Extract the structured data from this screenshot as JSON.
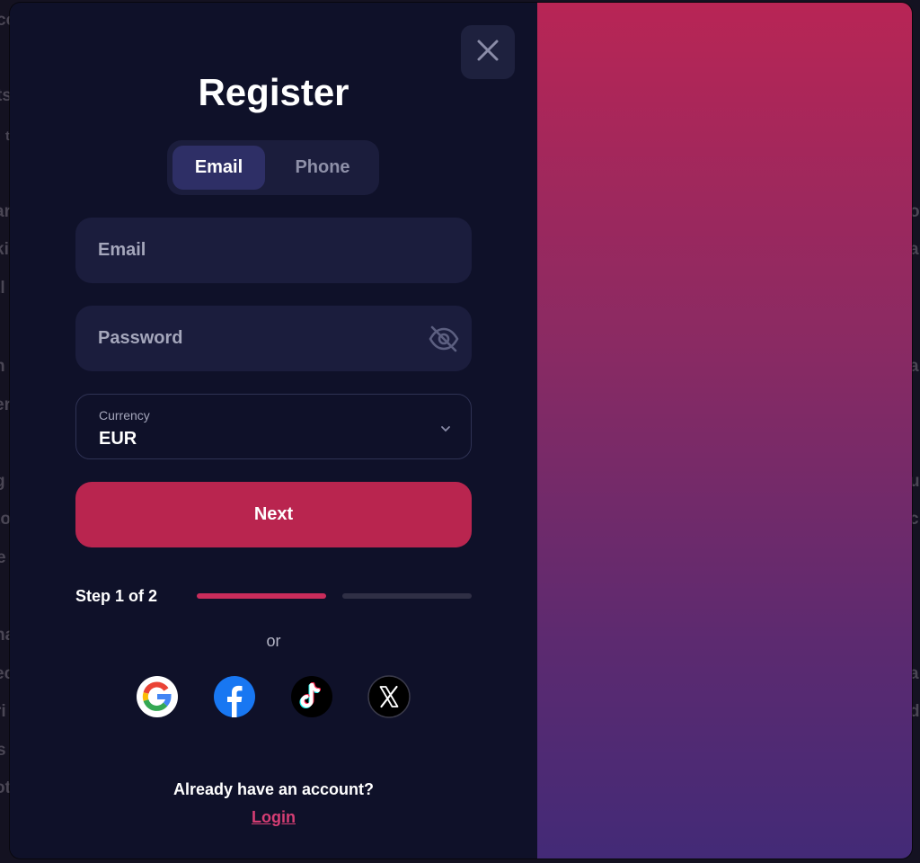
{
  "background": {
    "fragments": [
      "co",
      "ts",
      "t",
      "ar",
      "ki",
      "tl",
      "n",
      "er",
      "g",
      "to",
      "e",
      "ha",
      "ec",
      "ri",
      "s",
      "ot",
      "ot",
      "ar",
      "a",
      "un",
      "c",
      "a",
      "d"
    ]
  },
  "modal": {
    "title": "Register",
    "tabs": [
      {
        "label": "Email",
        "active": true
      },
      {
        "label": "Phone",
        "active": false
      }
    ],
    "email_placeholder": "Email",
    "password_placeholder": "Password",
    "currency": {
      "label": "Currency",
      "value": "EUR"
    },
    "next_label": "Next",
    "step": {
      "text": "Step 1 of 2",
      "current": 1,
      "total": 2
    },
    "or_label": "or",
    "social": [
      "google",
      "facebook",
      "tiktok",
      "x"
    ],
    "footer": {
      "prompt": "Already have an account?",
      "login_label": "Login"
    }
  },
  "colors": {
    "panel_bg": "#0f1129",
    "accent": "#b9254f",
    "link": "#d63e74",
    "gradient_top": "#b82555",
    "gradient_bottom": "#432a77"
  }
}
